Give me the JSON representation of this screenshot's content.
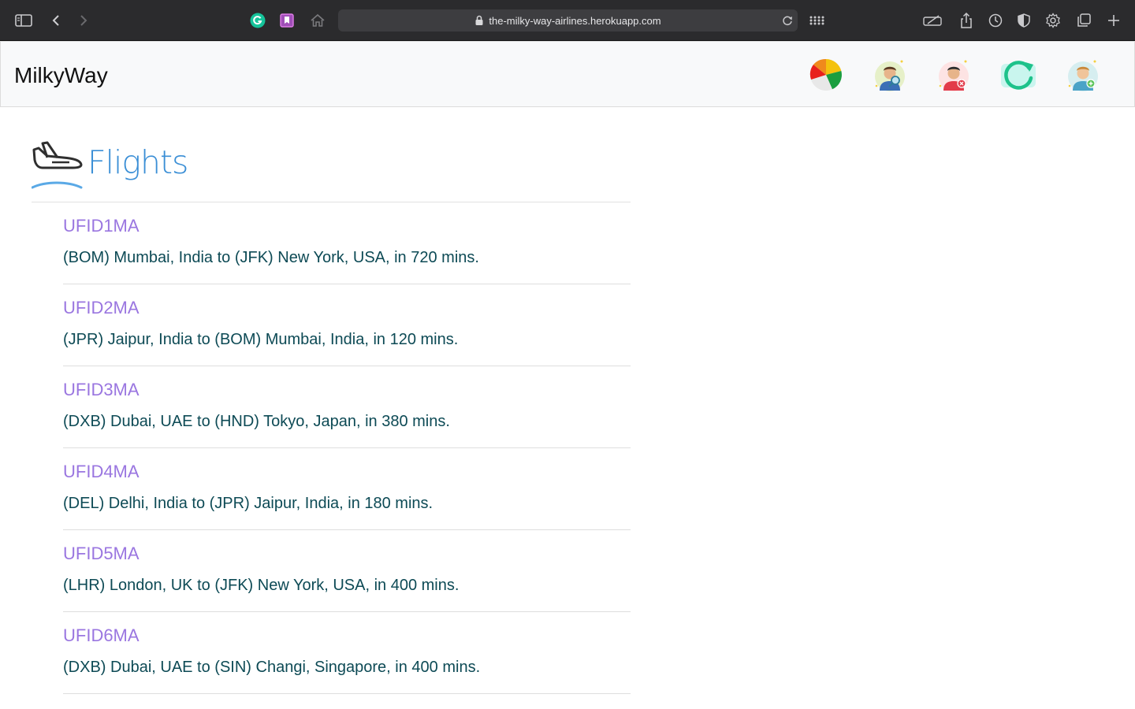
{
  "browser": {
    "url": "the-milky-way-airlines.herokuapp.com"
  },
  "navbar": {
    "brand": "MilkyWay",
    "icons": [
      "pie-chart-icon",
      "search-user-icon",
      "remove-user-icon",
      "refresh-icon",
      "add-user-icon"
    ]
  },
  "page": {
    "title": "Flights"
  },
  "flights": [
    {
      "id": "UFID1MA",
      "route": "(BOM) Mumbai, India to (JFK) New York, USA, in 720 mins."
    },
    {
      "id": "UFID2MA",
      "route": "(JPR) Jaipur, India to (BOM) Mumbai, India, in 120 mins."
    },
    {
      "id": "UFID3MA",
      "route": "(DXB) Dubai, UAE to (HND) Tokyo, Japan, in 380 mins."
    },
    {
      "id": "UFID4MA",
      "route": "(DEL) Delhi, India to (JPR) Jaipur, India, in 180 mins."
    },
    {
      "id": "UFID5MA",
      "route": "(LHR) London, UK to (JFK) New York, USA, in 400 mins."
    },
    {
      "id": "UFID6MA",
      "route": "(DXB) Dubai, UAE to (SIN) Changi, Singapore, in 400 mins."
    }
  ]
}
